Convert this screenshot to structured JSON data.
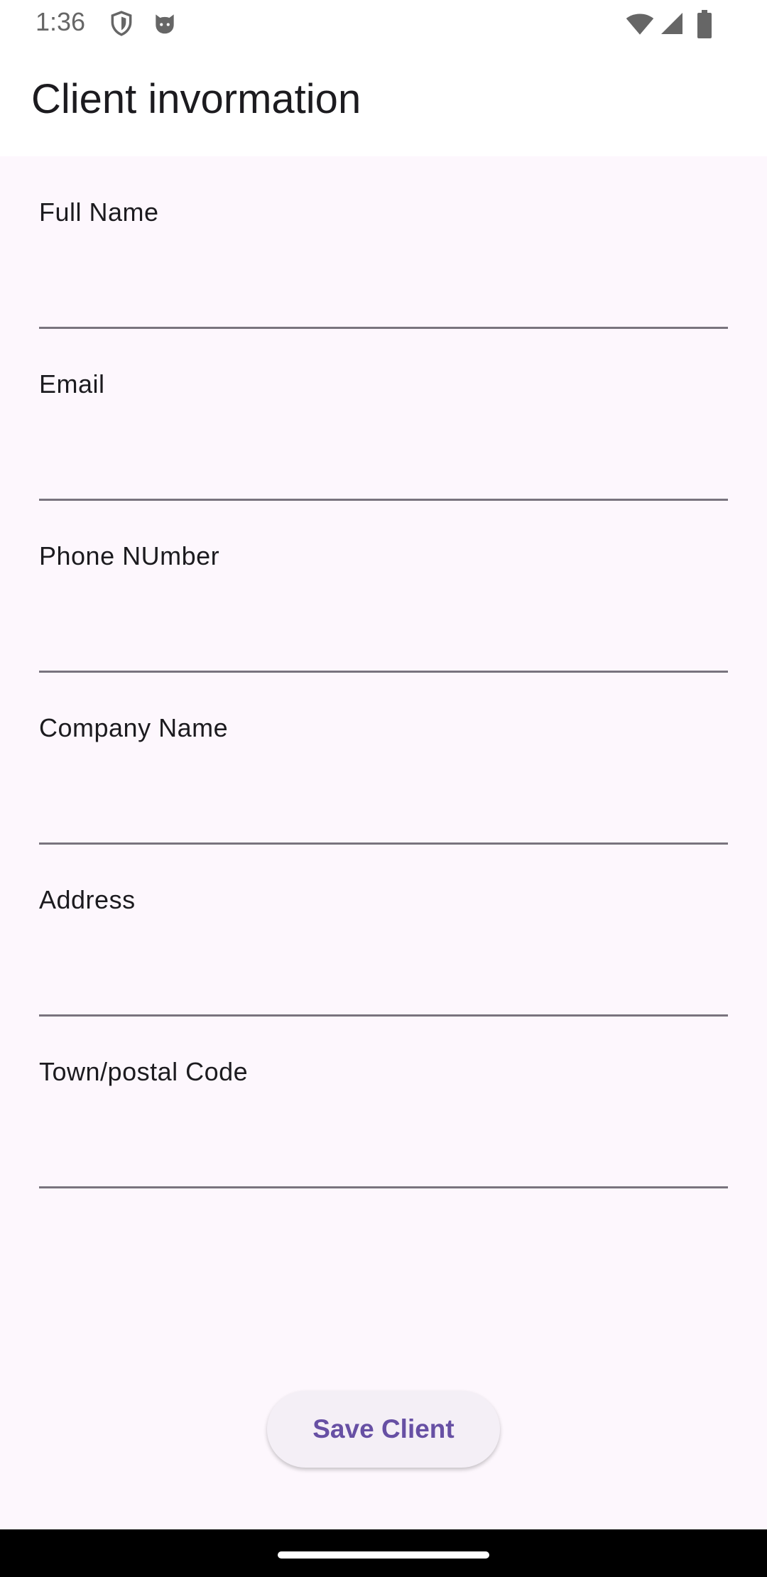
{
  "status_bar": {
    "time": "1:36",
    "icons": [
      "shield-icon",
      "cat-face-icon",
      "wifi-icon",
      "signal-icon",
      "battery-icon"
    ]
  },
  "app_bar": {
    "title": "Client invormation"
  },
  "form": {
    "fields": [
      {
        "label": "Full Name",
        "value": ""
      },
      {
        "label": "Email",
        "value": ""
      },
      {
        "label": "Phone NUmber",
        "value": ""
      },
      {
        "label": "Company Name",
        "value": ""
      },
      {
        "label": "Address",
        "value": ""
      },
      {
        "label": "Town/postal Code",
        "value": ""
      }
    ],
    "save_label": "Save Client"
  },
  "colors": {
    "background": "#fdf7fd",
    "accent": "#6750a4",
    "underline": "#79747e"
  }
}
